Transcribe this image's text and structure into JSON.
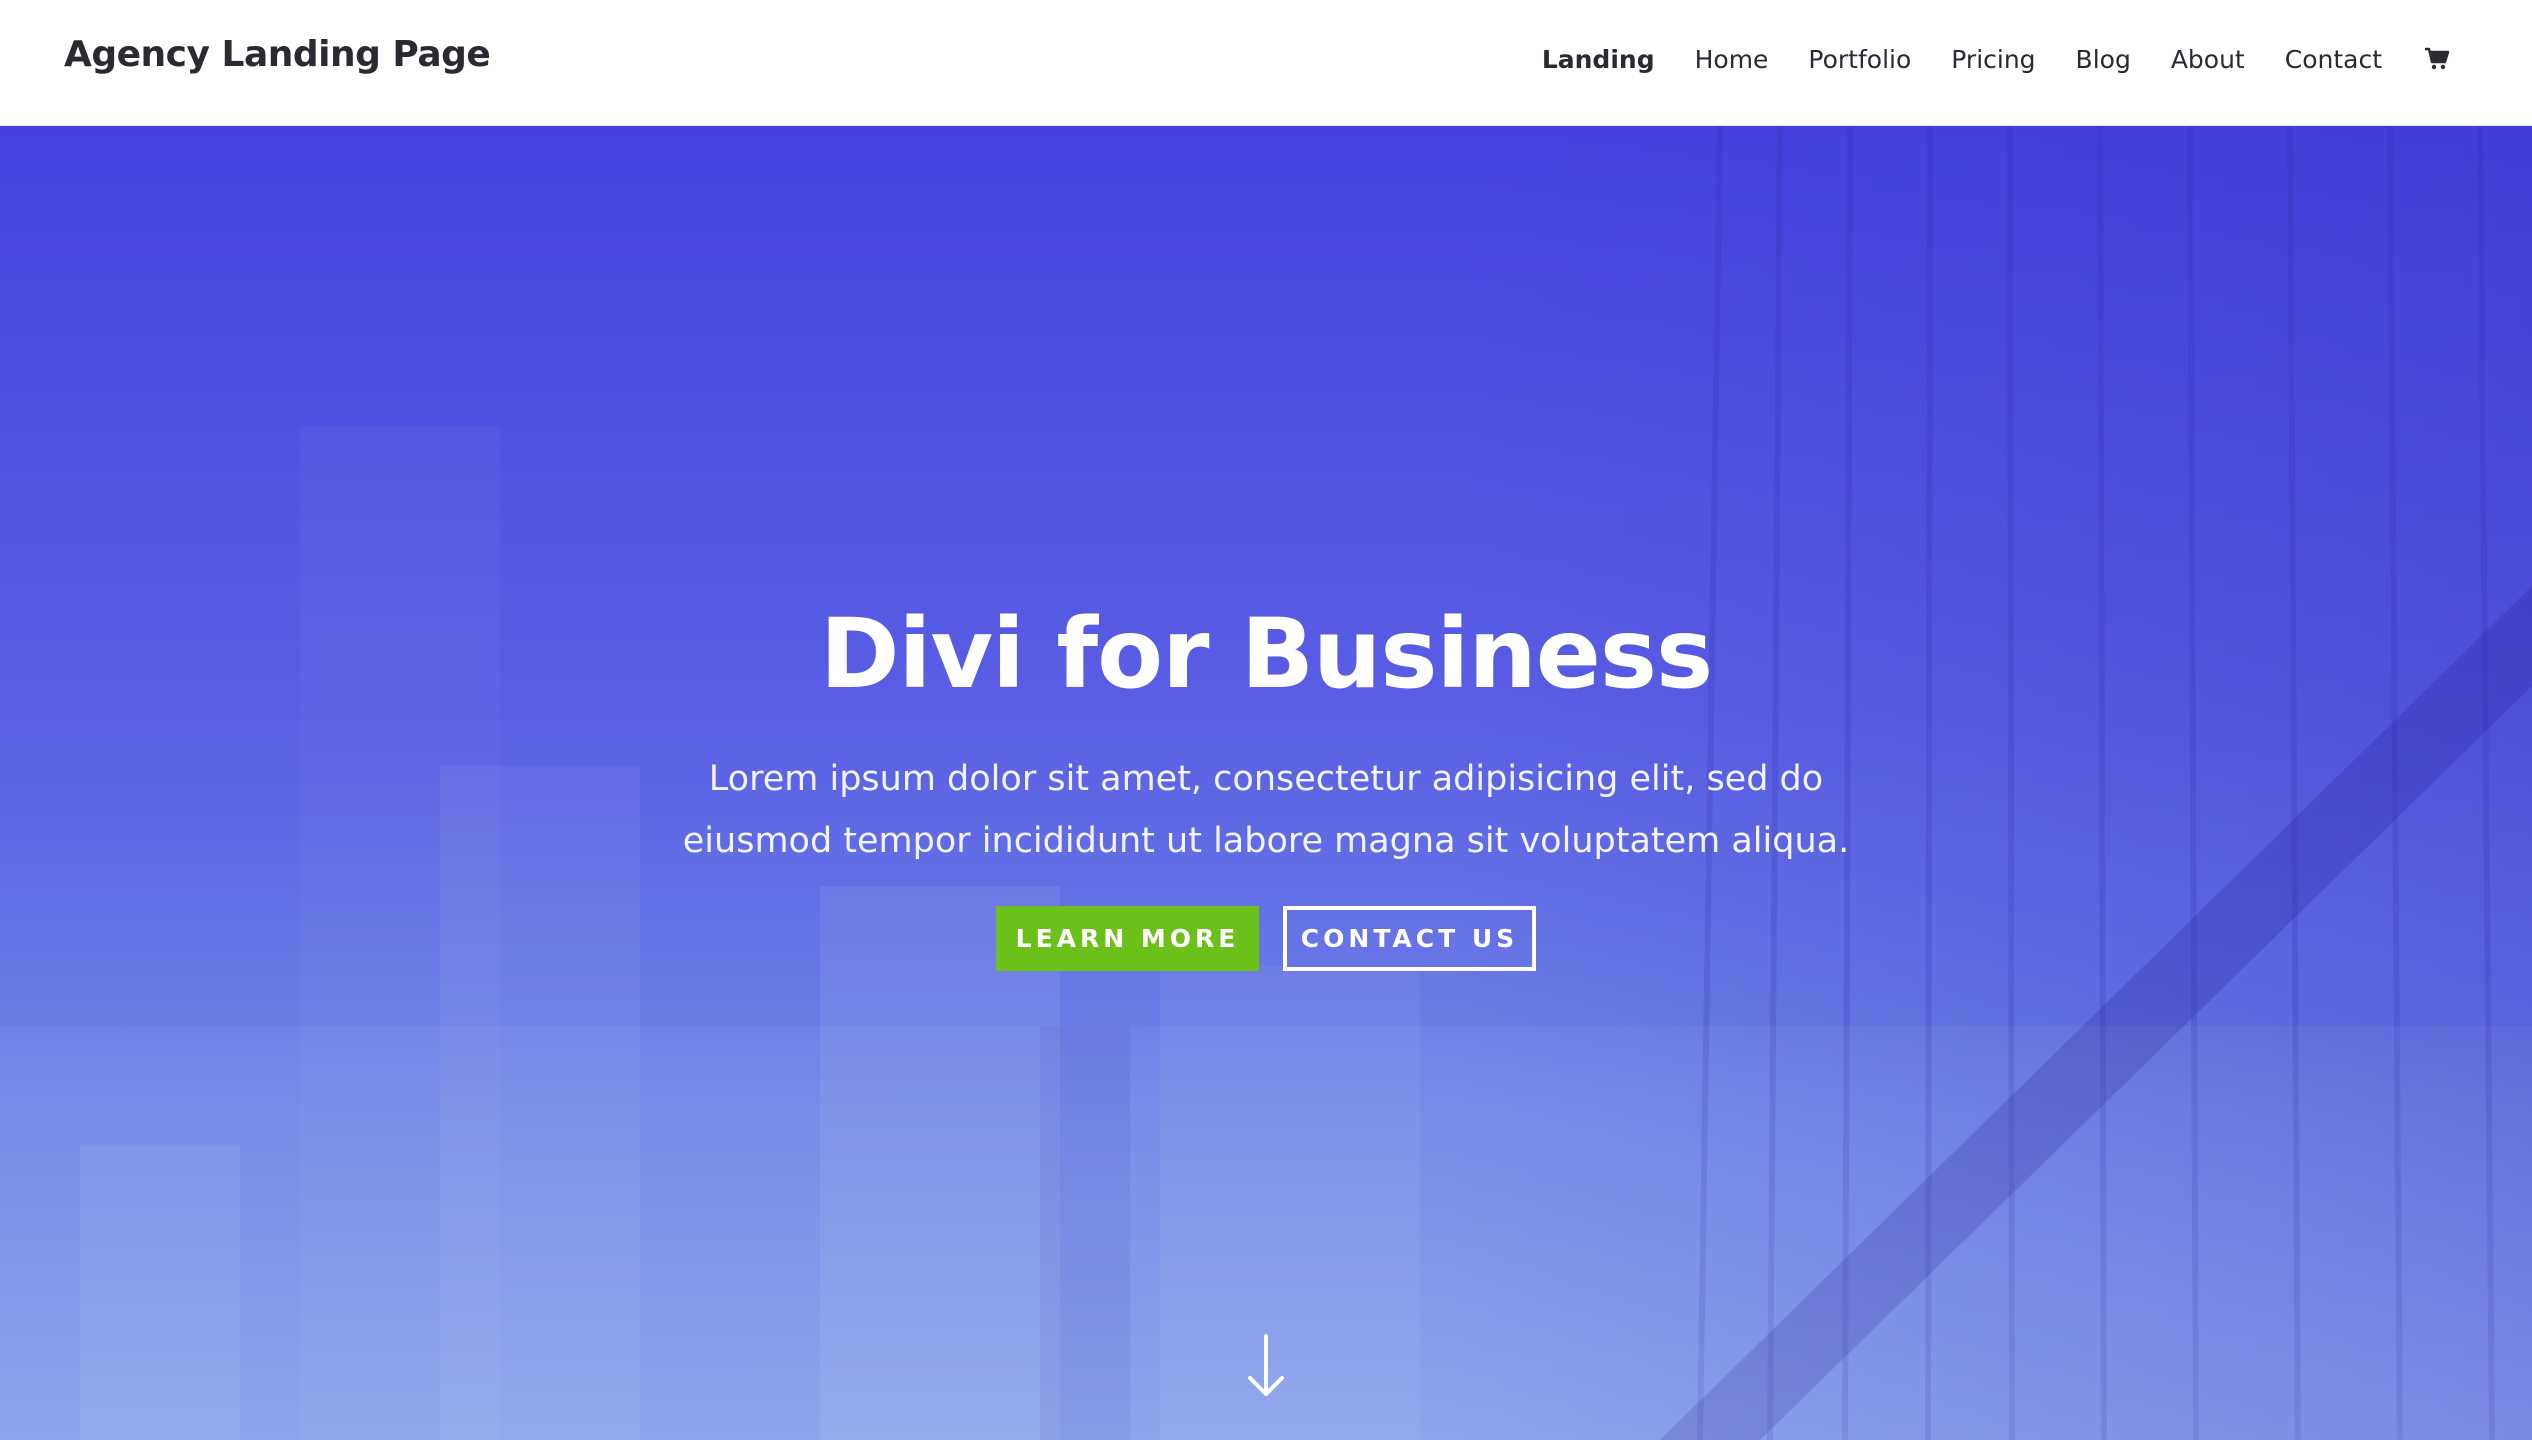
{
  "header": {
    "site_title": "Agency Landing Page",
    "nav": [
      {
        "label": "Landing",
        "active": true
      },
      {
        "label": "Home",
        "active": false
      },
      {
        "label": "Portfolio",
        "active": false
      },
      {
        "label": "Pricing",
        "active": false
      },
      {
        "label": "Blog",
        "active": false
      },
      {
        "label": "About",
        "active": false
      },
      {
        "label": "Contact",
        "active": false
      }
    ],
    "cart_icon": "shopping-cart-icon"
  },
  "hero": {
    "title": "Divi for Business",
    "subtitle": "Lorem ipsum dolor sit amet, consectetur adipisicing elit, sed do eiusmod tempor incididunt ut labore magna sit voluptatem aliqua.",
    "primary_button": "LEARN MORE",
    "secondary_button": "CONTACT US",
    "scroll_icon": "arrow-down-icon"
  },
  "colors": {
    "hero_top": "#4542e0",
    "hero_bottom": "#7893e8",
    "primary_button": "#6cc01a",
    "text_dark": "#2a2a33"
  }
}
